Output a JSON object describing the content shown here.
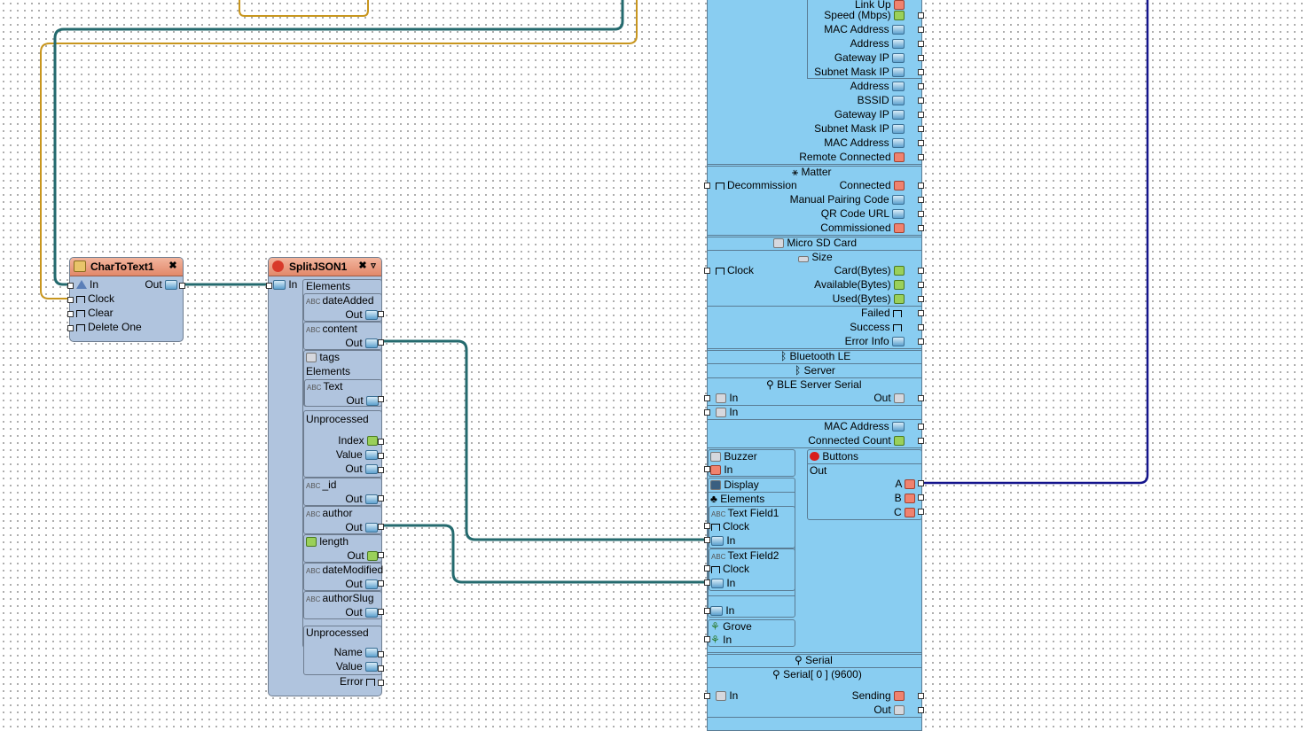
{
  "colors": {
    "wire_teal": "#246a6e",
    "wire_orange": "#c8961e",
    "wire_navy": "#14148c",
    "component_body": "#b0c4de",
    "component_header": "#e8957a",
    "board_body": "#89cdf1"
  },
  "chartotext": {
    "title": "CharToText1",
    "pins": {
      "in": "In",
      "clock": "Clock",
      "clear": "Clear",
      "delete_one": "Delete One",
      "out": "Out"
    }
  },
  "splitjson": {
    "title": "SplitJSON1",
    "in_label": "In",
    "elements_header": "Elements",
    "date_added": "dateAdded",
    "content": "content",
    "tags": "tags",
    "tags_elements": "Elements",
    "text": "Text",
    "unprocessed": "Unprocessed",
    "index": "Index",
    "value": "Value",
    "id": "_id",
    "author": "author",
    "length": "length",
    "date_modified": "dateModified",
    "author_slug": "authorSlug",
    "unprocessed2": "Unprocessed",
    "name": "Name",
    "value2": "Value",
    "error": "Error",
    "out": "Out"
  },
  "board": {
    "wifi": {
      "link_up": "Link Up",
      "speed": "Speed (Mbps)",
      "mac_address": "MAC Address",
      "address": "Address",
      "gateway_ip": "Gateway IP",
      "subnet_mask_ip": "Subnet Mask IP",
      "address2": "Address",
      "bssid": "BSSID",
      "gateway_ip2": "Gateway IP",
      "subnet_mask_ip2": "Subnet Mask IP",
      "mac_address2": "MAC Address",
      "remote_connected": "Remote Connected"
    },
    "matter": {
      "title": "Matter",
      "decommission": "Decommission",
      "connected": "Connected",
      "manual_pairing_code": "Manual Pairing Code",
      "qr_code_url": "QR Code URL",
      "commissioned": "Commissioned"
    },
    "sd": {
      "title": "Micro SD Card",
      "size": "Size",
      "clock": "Clock",
      "card_bytes": "Card(Bytes)",
      "available_bytes": "Available(Bytes)",
      "used_bytes": "Used(Bytes)",
      "failed": "Failed",
      "success": "Success",
      "error_info": "Error Info"
    },
    "ble": {
      "title": "Bluetooth LE",
      "server": "Server",
      "serial": "BLE Server Serial",
      "in": "In",
      "out": "Out",
      "in2": "In",
      "mac_address": "MAC Address",
      "connected_count": "Connected Count"
    },
    "buzzer": {
      "title": "Buzzer",
      "in": "In"
    },
    "display": {
      "title": "Display",
      "elements": "Elements",
      "text_field1": "Text Field1",
      "clock1": "Clock",
      "in1": "In",
      "text_field2": "Text Field2",
      "clock2": "Clock",
      "in2": "In",
      "in3": "In"
    },
    "grove": {
      "title": "Grove",
      "in": "In"
    },
    "buttons": {
      "title": "Buttons",
      "out": "Out",
      "a": "A",
      "b": "B",
      "c": "C"
    },
    "serial": {
      "title": "Serial",
      "serial0": "Serial[ 0 ] (9600)",
      "in": "In",
      "sending": "Sending",
      "out": "Out"
    }
  }
}
